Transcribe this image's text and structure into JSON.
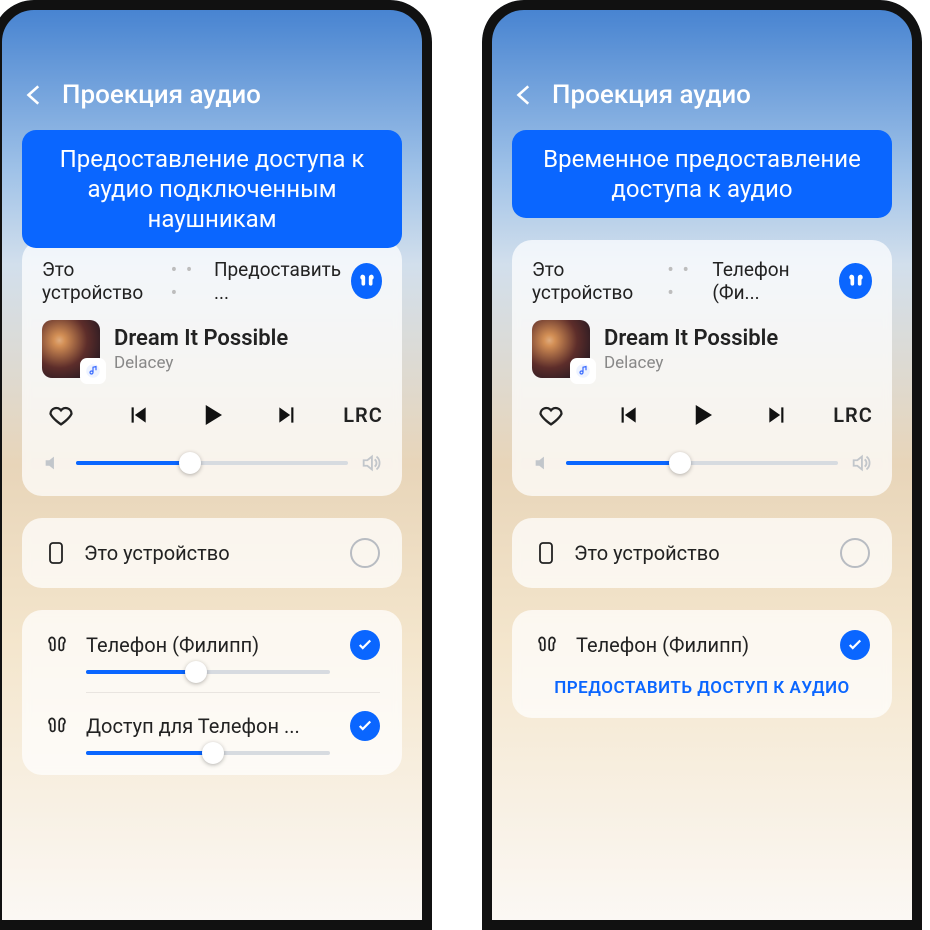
{
  "page_title": "Проекция аудио",
  "callout_left": "Предоставление доступа к аудио подключенным наушникам",
  "callout_right": "Временное предоставление доступа к аудио",
  "player": {
    "tab_this_device": "Это устройство",
    "tab_share_left": "Предоставить ...",
    "tab_share_right": "Телефон (Фи...",
    "song_title": "Dream It Possible",
    "song_artist": "Delacey",
    "lrc_label": "LRC",
    "volume_percent": 42
  },
  "devices": {
    "this_device_label": "Это устройство",
    "left_phone1": "Телефон (Филипп)",
    "left_phone1_vol": 45,
    "left_phone2": "Доступ для Телефон ...",
    "left_phone2_vol": 52,
    "right_phone": "Телефон (Филипп)",
    "share_button": "ПРЕДОСТАВИТЬ ДОСТУП К АУДИО"
  },
  "colors": {
    "accent": "#0a66ff"
  }
}
